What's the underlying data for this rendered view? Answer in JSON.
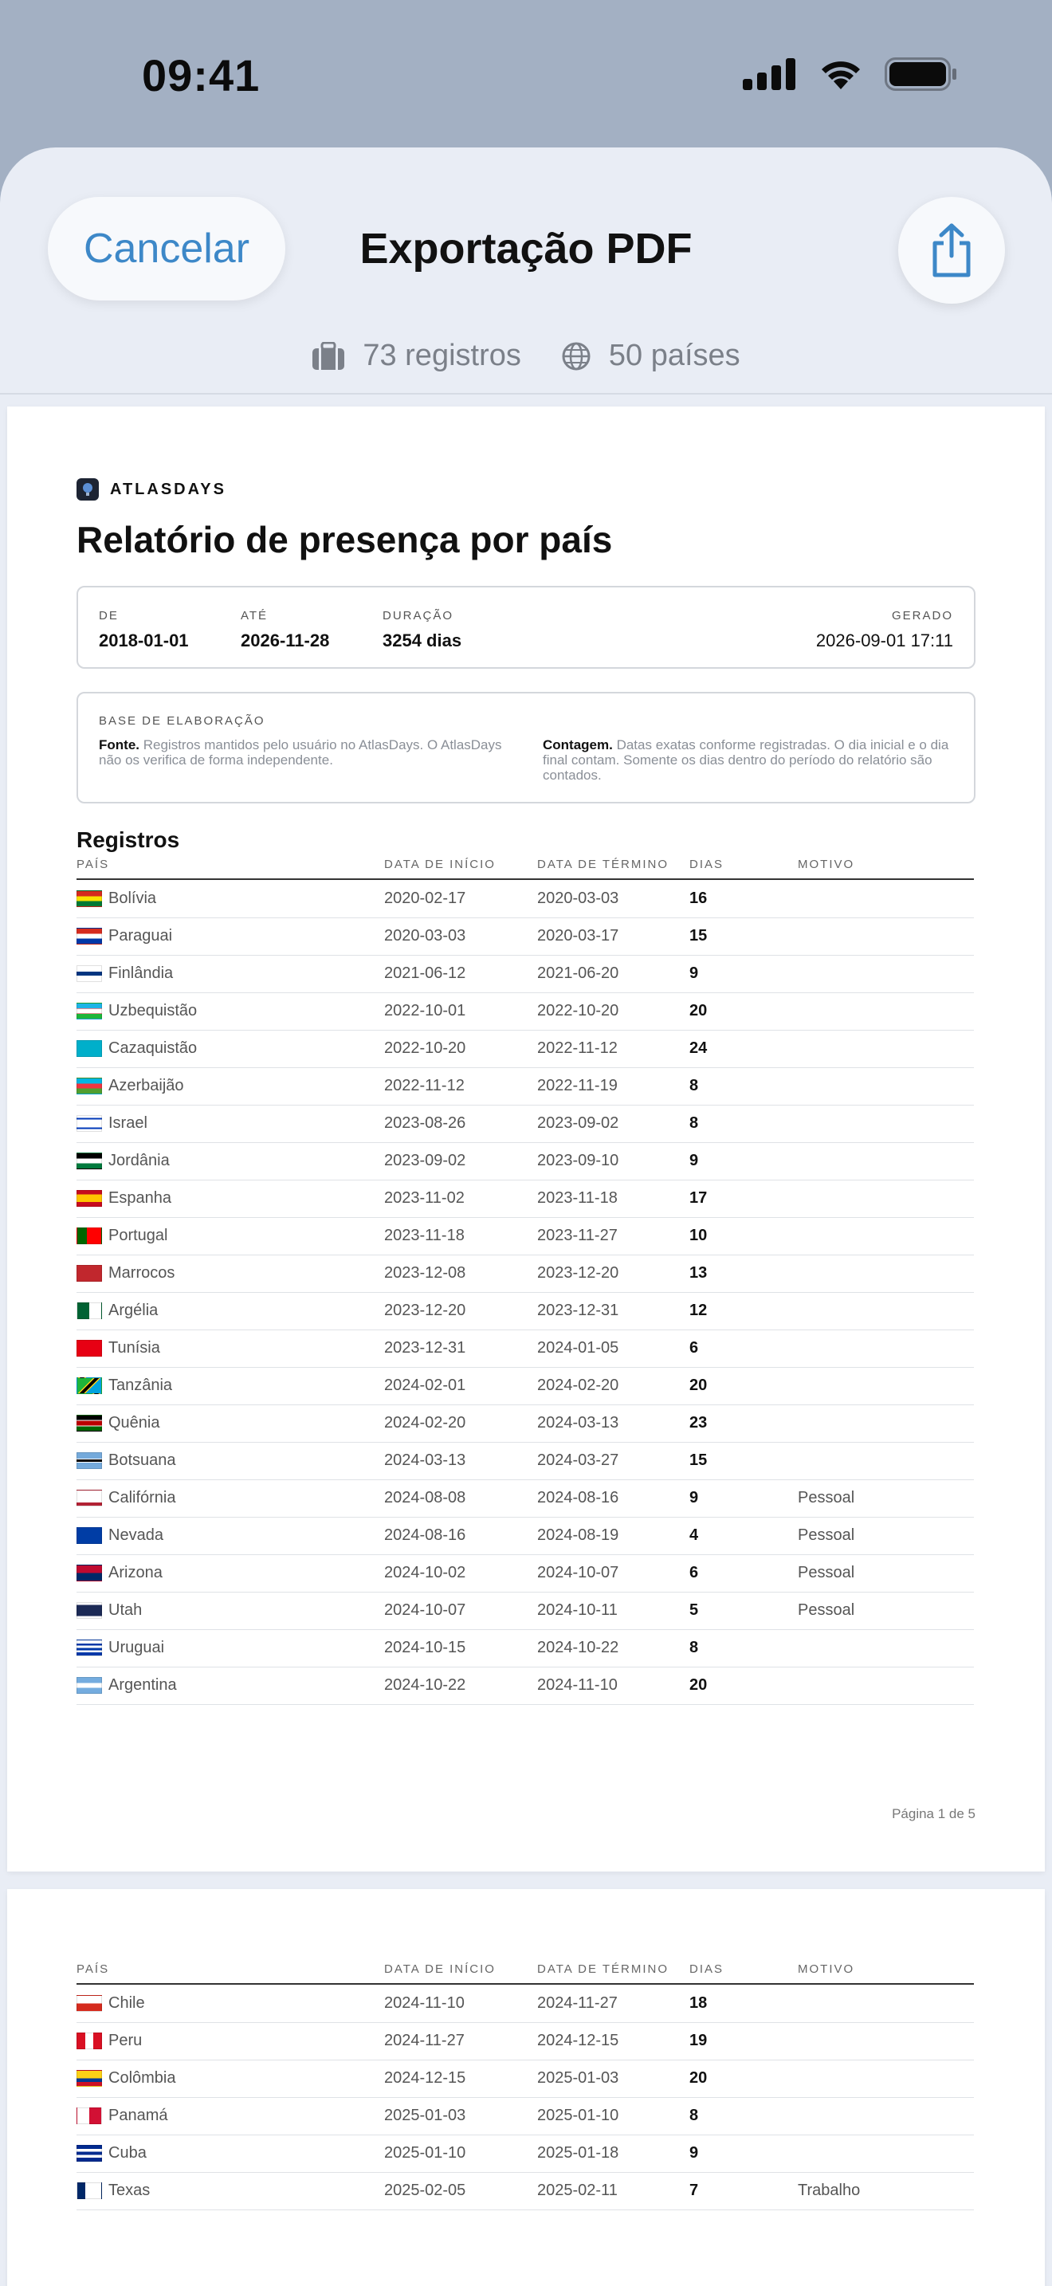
{
  "status_bar": {
    "time": "09:41"
  },
  "nav": {
    "cancel_label": "Cancelar",
    "title": "Exportação PDF",
    "share_icon": "share-icon"
  },
  "stats": {
    "records": "73 registros",
    "countries": "50 países"
  },
  "report": {
    "brand": "ATLASDAYS",
    "title": "Relatório de presença por país",
    "meta": {
      "from_label": "DE",
      "from_value": "2018-01-01",
      "to_label": "ATÉ",
      "to_value": "2026-11-28",
      "duration_label": "DURAÇÃO",
      "duration_value": "3254 dias",
      "generated_label": "GERADO",
      "generated_value": "2026-09-01 17:11"
    },
    "basis": {
      "label": "BASE DE ELABORAÇÃO",
      "source_title": "Fonte.",
      "source_text": "Registros mantidos pelo usuário no AtlasDays. O AtlasDays não os verifica de forma independente.",
      "count_title": "Contagem.",
      "count_text": "Datas exatas conforme registradas. O dia inicial e o dia final contam. Somente os dias dentro do período do relatório são contados."
    },
    "section_title": "Registros",
    "columns": {
      "country": "PAÍS",
      "start": "DATA DE INÍCIO",
      "end": "DATA DE TÉRMINO",
      "days": "DIAS",
      "reason": "MOTIVO"
    },
    "page1_rows": [
      {
        "country": "Bolívia",
        "start": "2020-02-17",
        "end": "2020-03-03",
        "days": "16",
        "reason": "",
        "flag": "bo"
      },
      {
        "country": "Paraguai",
        "start": "2020-03-03",
        "end": "2020-03-17",
        "days": "15",
        "reason": "",
        "flag": "py"
      },
      {
        "country": "Finlândia",
        "start": "2021-06-12",
        "end": "2021-06-20",
        "days": "9",
        "reason": "",
        "flag": "fi"
      },
      {
        "country": "Uzbequistão",
        "start": "2022-10-01",
        "end": "2022-10-20",
        "days": "20",
        "reason": "",
        "flag": "uz"
      },
      {
        "country": "Cazaquistão",
        "start": "2022-10-20",
        "end": "2022-11-12",
        "days": "24",
        "reason": "",
        "flag": "kz"
      },
      {
        "country": "Azerbaijão",
        "start": "2022-11-12",
        "end": "2022-11-19",
        "days": "8",
        "reason": "",
        "flag": "az"
      },
      {
        "country": "Israel",
        "start": "2023-08-26",
        "end": "2023-09-02",
        "days": "8",
        "reason": "",
        "flag": "il"
      },
      {
        "country": "Jordânia",
        "start": "2023-09-02",
        "end": "2023-09-10",
        "days": "9",
        "reason": "",
        "flag": "jo"
      },
      {
        "country": "Espanha",
        "start": "2023-11-02",
        "end": "2023-11-18",
        "days": "17",
        "reason": "",
        "flag": "es"
      },
      {
        "country": "Portugal",
        "start": "2023-11-18",
        "end": "2023-11-27",
        "days": "10",
        "reason": "",
        "flag": "pt"
      },
      {
        "country": "Marrocos",
        "start": "2023-12-08",
        "end": "2023-12-20",
        "days": "13",
        "reason": "",
        "flag": "ma"
      },
      {
        "country": "Argélia",
        "start": "2023-12-20",
        "end": "2023-12-31",
        "days": "12",
        "reason": "",
        "flag": "dz"
      },
      {
        "country": "Tunísia",
        "start": "2023-12-31",
        "end": "2024-01-05",
        "days": "6",
        "reason": "",
        "flag": "tn"
      },
      {
        "country": "Tanzânia",
        "start": "2024-02-01",
        "end": "2024-02-20",
        "days": "20",
        "reason": "",
        "flag": "tz"
      },
      {
        "country": "Quênia",
        "start": "2024-02-20",
        "end": "2024-03-13",
        "days": "23",
        "reason": "",
        "flag": "ke"
      },
      {
        "country": "Botsuana",
        "start": "2024-03-13",
        "end": "2024-03-27",
        "days": "15",
        "reason": "",
        "flag": "bw"
      },
      {
        "country": "Califórnia",
        "start": "2024-08-08",
        "end": "2024-08-16",
        "days": "9",
        "reason": "Pessoal",
        "flag": "ca_us"
      },
      {
        "country": "Nevada",
        "start": "2024-08-16",
        "end": "2024-08-19",
        "days": "4",
        "reason": "Pessoal",
        "flag": "nv"
      },
      {
        "country": "Arizona",
        "start": "2024-10-02",
        "end": "2024-10-07",
        "days": "6",
        "reason": "Pessoal",
        "flag": "az_us"
      },
      {
        "country": "Utah",
        "start": "2024-10-07",
        "end": "2024-10-11",
        "days": "5",
        "reason": "Pessoal",
        "flag": "ut"
      },
      {
        "country": "Uruguai",
        "start": "2024-10-15",
        "end": "2024-10-22",
        "days": "8",
        "reason": "",
        "flag": "uy"
      },
      {
        "country": "Argentina",
        "start": "2024-10-22",
        "end": "2024-11-10",
        "days": "20",
        "reason": "",
        "flag": "ar"
      }
    ],
    "page1_footer": "Página 1 de 5",
    "page2_rows": [
      {
        "country": "Chile",
        "start": "2024-11-10",
        "end": "2024-11-27",
        "days": "18",
        "reason": "",
        "flag": "cl"
      },
      {
        "country": "Peru",
        "start": "2024-11-27",
        "end": "2024-12-15",
        "days": "19",
        "reason": "",
        "flag": "pe"
      },
      {
        "country": "Colômbia",
        "start": "2024-12-15",
        "end": "2025-01-03",
        "days": "20",
        "reason": "",
        "flag": "co"
      },
      {
        "country": "Panamá",
        "start": "2025-01-03",
        "end": "2025-01-10",
        "days": "8",
        "reason": "",
        "flag": "pa"
      },
      {
        "country": "Cuba",
        "start": "2025-01-10",
        "end": "2025-01-18",
        "days": "9",
        "reason": "",
        "flag": "cu"
      },
      {
        "country": "Texas",
        "start": "2025-02-05",
        "end": "2025-02-11",
        "days": "7",
        "reason": "Trabalho",
        "flag": "tx"
      }
    ]
  }
}
